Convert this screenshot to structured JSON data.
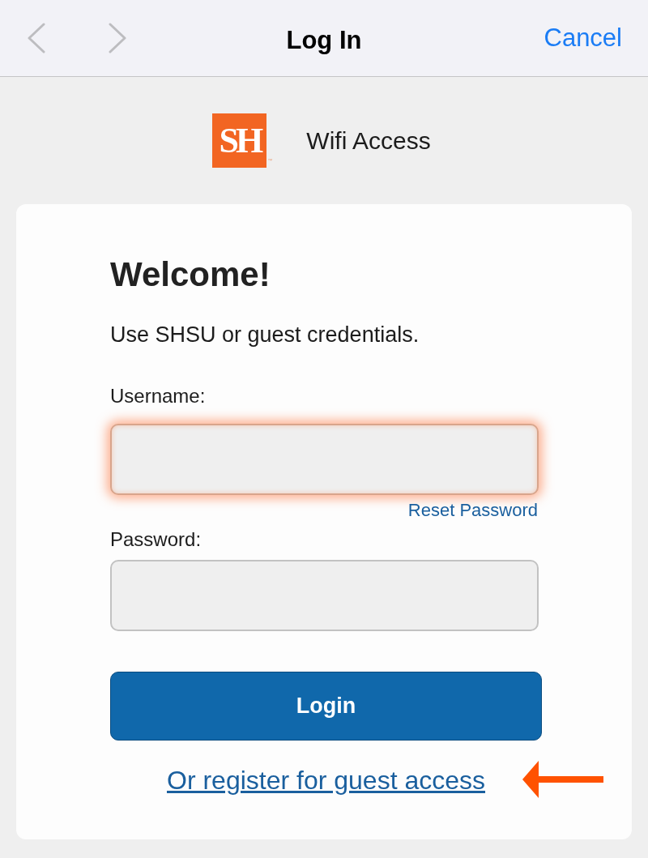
{
  "nav_bar": {
    "back": {
      "disabled": true
    },
    "forward": {
      "disabled": true
    },
    "title": "Log In",
    "cancel": "Cancel"
  },
  "header": {
    "logo": {
      "letters": "SH",
      "trademark": "™"
    },
    "title": "Wifi Access"
  },
  "form": {
    "heading": "Welcome!",
    "subtitle": "Use SHSU or guest credentials.",
    "fields": [
      {
        "label": "Username:",
        "focused": true
      },
      {
        "label": "Password:",
        "focused": false,
        "link": "Reset Password"
      }
    ],
    "submit": "Login",
    "register_link": "Or register for guest access"
  }
}
